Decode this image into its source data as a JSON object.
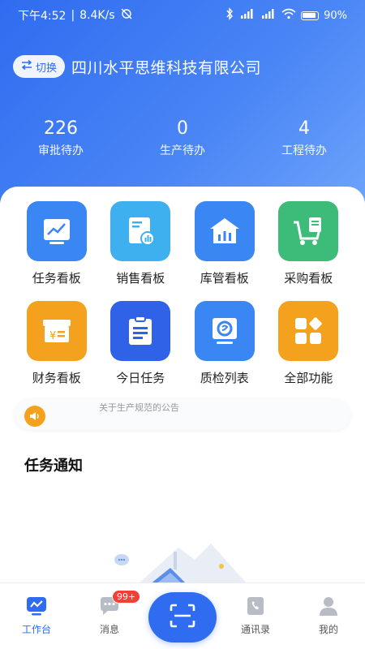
{
  "status_bar": {
    "time": "下午4:52",
    "speed": "8.4K/s",
    "battery": "90%"
  },
  "header": {
    "switch_label": "切换",
    "company_name": "四川水平思维科技有限公司"
  },
  "stats": [
    {
      "value": "226",
      "label": "审批待办"
    },
    {
      "value": "0",
      "label": "生产待办"
    },
    {
      "value": "4",
      "label": "工程待办"
    }
  ],
  "grid": [
    {
      "label": "任务看板",
      "icon": "chart-board-icon",
      "color": "#3a86f2"
    },
    {
      "label": "销售看板",
      "icon": "sales-doc-icon",
      "color": "#3fb0ef"
    },
    {
      "label": "库管看板",
      "icon": "warehouse-icon",
      "color": "#3a86f2"
    },
    {
      "label": "采购看板",
      "icon": "shopping-cart-icon",
      "color": "#3dbb78"
    },
    {
      "label": "财务看板",
      "icon": "finance-box-icon",
      "color": "#f4a21d"
    },
    {
      "label": "今日任务",
      "icon": "clipboard-icon",
      "color": "#2f62e6"
    },
    {
      "label": "质检列表",
      "icon": "inspection-icon",
      "color": "#3a86f2"
    },
    {
      "label": "全部功能",
      "icon": "all-apps-icon",
      "color": "#f4a21d"
    }
  ],
  "notice": {
    "text": "关于生产规范的公告"
  },
  "task_section": {
    "title": "任务通知"
  },
  "tabbar": {
    "tabs": [
      {
        "label": "工作台",
        "icon": "workbench-icon",
        "active": true
      },
      {
        "label": "消息",
        "icon": "message-icon",
        "badge": "99+"
      },
      {
        "label": "通讯录",
        "icon": "contacts-icon"
      },
      {
        "label": "我的",
        "icon": "profile-icon"
      }
    ],
    "scan_icon": "scan-icon"
  },
  "colors": {
    "primary": "#2f6cf0",
    "badge": "#f04134"
  }
}
